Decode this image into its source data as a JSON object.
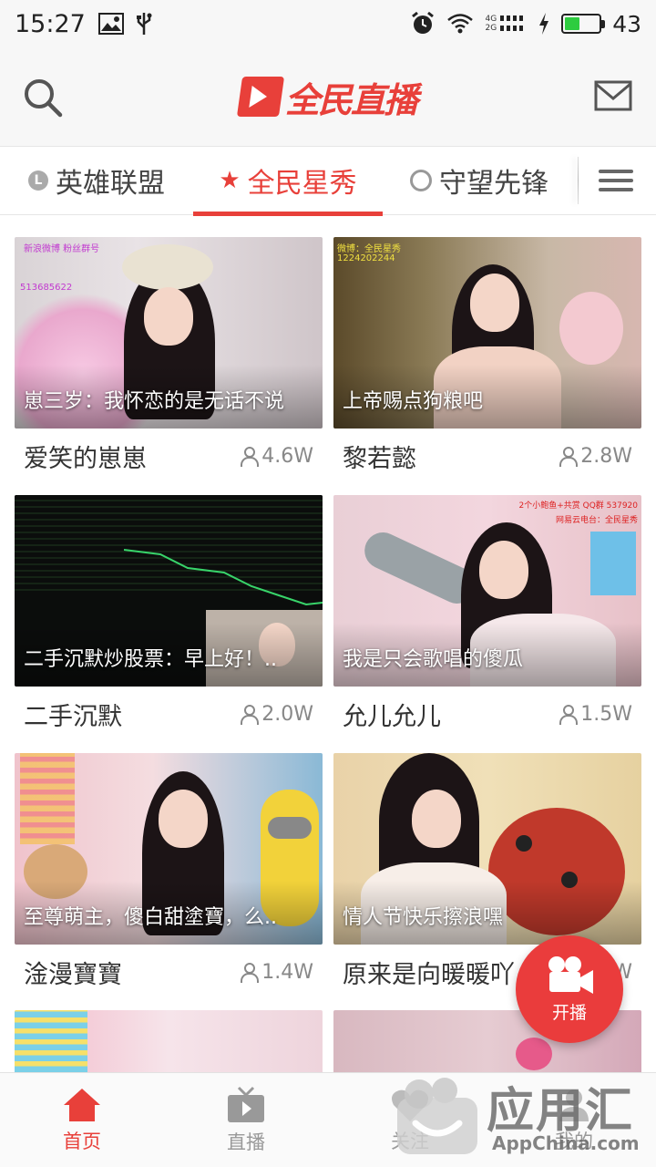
{
  "status_bar": {
    "time": "15:27",
    "network_4g": "4G",
    "network_2g": "2G",
    "battery_level": "43",
    "battery_fraction": 0.43
  },
  "header": {
    "logo_text": "全民直播",
    "search_icon": "search-icon",
    "mail_icon": "mail-icon"
  },
  "tabs": [
    {
      "label": "英雄联盟",
      "icon": "L"
    },
    {
      "label": "全民星秀",
      "icon": "star-icon",
      "active": true
    },
    {
      "label": "守望先锋",
      "icon": "overwatch-icon"
    }
  ],
  "cards": [
    {
      "caption": "崽三岁：我怀恋的是无话不说",
      "name": "爱笑的崽崽",
      "views": "4.6W"
    },
    {
      "caption": "上帝赐点狗粮吧",
      "name": "黎若懿",
      "views": "2.8W"
    },
    {
      "caption": "二手沉默炒股票：早上好！..",
      "name": "二手沉默",
      "views": "2.0W"
    },
    {
      "caption": "我是只会歌唱的傻瓜",
      "name": "允儿允儿",
      "views": "1.5W"
    },
    {
      "caption": "至尊萌主，傻白甜塗寶，么..",
      "name": "淦漫寶寶",
      "views": "1.4W"
    },
    {
      "caption": "情人节快乐擦浪嘿",
      "name": "原来是向暖暖吖",
      "views": "W"
    }
  ],
  "thumb_overlay_text": {
    "card1_top": "新浪微博  粉丝群号",
    "card1_code": "513685622",
    "card2_top": "微博：全民星秀",
    "card2_code": "1224202244",
    "card4_top": "2个小鲍鱼+共赏  QQ群 537920",
    "card4_side": "网易云电台：全民星秀"
  },
  "float_button": {
    "label": "开播"
  },
  "bottom_nav": [
    {
      "label": "首页",
      "active": true
    },
    {
      "label": "直播"
    },
    {
      "label": "关注"
    },
    {
      "label": "我的"
    }
  ],
  "watermark": {
    "text": "应用汇",
    "sub": "AppChina.com"
  },
  "colors": {
    "accent": "#e8403a",
    "live_button": "#ea3c3c"
  }
}
